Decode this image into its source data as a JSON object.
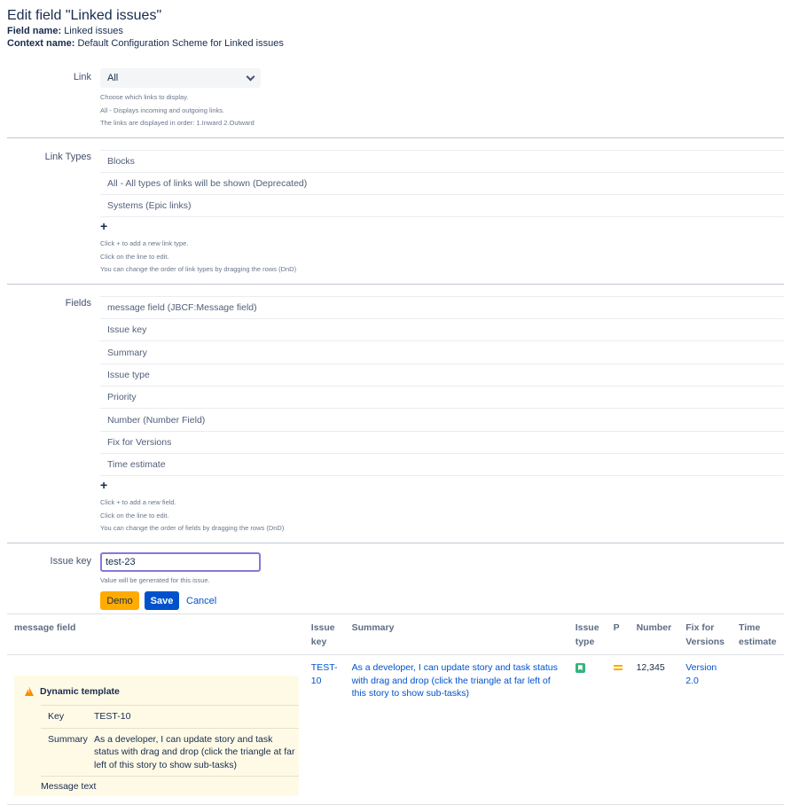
{
  "page": {
    "title": "Edit field \"Linked issues\"",
    "field_name_label": "Field name:",
    "field_name_value": "Linked issues",
    "context_name_label": "Context name:",
    "context_name_value": "Default Configuration Scheme for Linked issues"
  },
  "link": {
    "label": "Link",
    "selected": "All",
    "help": [
      "Choose which links to display.",
      "All - Displays incoming and outgoing links.",
      "The links are displayed in order: 1.Inward 2.Outward"
    ]
  },
  "link_types": {
    "label": "Link Types",
    "items": [
      "Blocks",
      "All - All types of links will be shown (Deprecated)",
      "Systems (Epic links)"
    ],
    "add": "+",
    "help": [
      "Click + to add a new link type.",
      "Click on the line to edit.",
      "You can change the order of link types by dragging the rows (DnD)"
    ]
  },
  "fields": {
    "label": "Fields",
    "items": [
      "message field (JBCF:Message field)",
      "Issue key",
      "Summary",
      "Issue type",
      "Priority",
      "Number (Number Field)",
      "Fix for Versions",
      "Time estimate"
    ],
    "add": "+",
    "help": [
      "Click + to add a new field.",
      "Click on the line to edit.",
      "You can change the order of fields by dragging the rows (DnD)"
    ]
  },
  "issue_key": {
    "label": "Issue key",
    "value": "test-23",
    "help": "Value will be generated for this issue."
  },
  "buttons": {
    "demo": "Demo",
    "save": "Save",
    "cancel": "Cancel"
  },
  "table": {
    "headers": [
      "message field",
      "Issue key",
      "Summary",
      "Issue type",
      "P",
      "Number",
      "Fix for Versions",
      "Time estimate"
    ],
    "row": {
      "issue_key": "TEST-10",
      "summary": "As a developer, I can update story and task status with drag and drop (click the triangle at far left of this story to show sub-tasks)",
      "issue_type_icon": "story-icon",
      "priority_icon": "medium-priority-icon",
      "number": "12,345",
      "fix_versions": "Version 2.0",
      "time_estimate": ""
    },
    "panel": {
      "title": "Dynamic template",
      "key_label": "Key",
      "key_value": "TEST-10",
      "summary_label": "Summary",
      "summary_value": "As a developer, I can update story and task status with drag and drop (click the triangle at far left of this story to show sub-tasks)",
      "message_label": "Message text"
    }
  },
  "colors": {
    "accent": "#0052cc",
    "demo_button": "#ffab00",
    "input_focus": "#8777d9",
    "panel_bg": "#fffae6",
    "story_green": "#36b37e"
  }
}
